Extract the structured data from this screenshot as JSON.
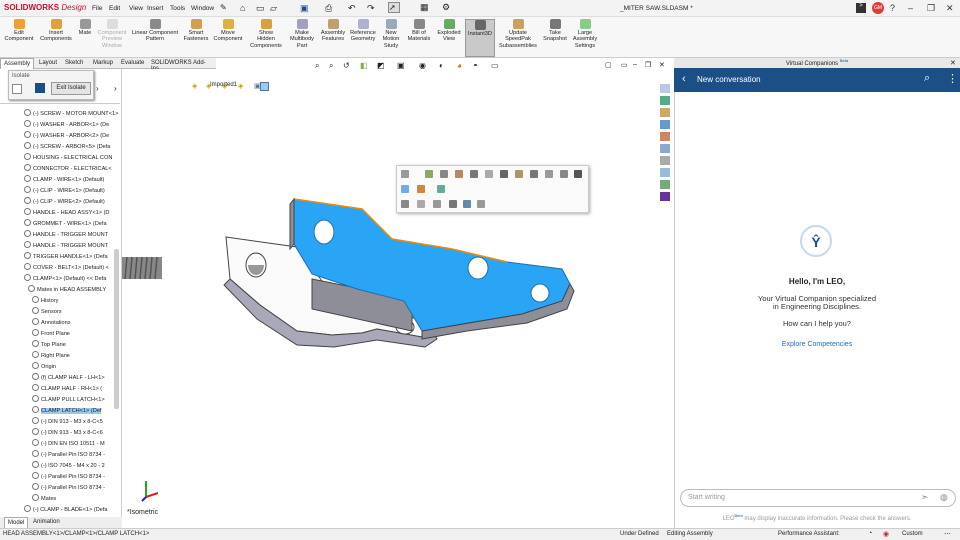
{
  "title_bar": {
    "logo_brand": "SOLIDWORKS",
    "logo_suffix": "Design",
    "menus": [
      "File",
      "Edit",
      "View",
      "Insert",
      "Tools",
      "Window"
    ],
    "filename": "_MITER SAW.SLDASM *",
    "user_initials": "GM"
  },
  "ribbon": {
    "buttons": [
      {
        "l1": "Edit",
        "l2": "Component",
        "l3": ""
      },
      {
        "l1": "Insert",
        "l2": "Components",
        "l3": ""
      },
      {
        "l1": "Mate",
        "l2": "",
        "l3": ""
      },
      {
        "l1": "Component",
        "l2": "Preview",
        "l3": "Window"
      },
      {
        "l1": "Linear Component",
        "l2": "Pattern",
        "l3": ""
      },
      {
        "l1": "Smart",
        "l2": "Fasteners",
        "l3": ""
      },
      {
        "l1": "Move",
        "l2": "Component",
        "l3": ""
      },
      {
        "l1": "Show",
        "l2": "Hidden",
        "l3": "Components"
      },
      {
        "l1": "Make",
        "l2": "Multibody",
        "l3": "Part"
      },
      {
        "l1": "Assembly",
        "l2": "Features",
        "l3": ""
      },
      {
        "l1": "Reference",
        "l2": "Geometry",
        "l3": ""
      },
      {
        "l1": "New",
        "l2": "Motion",
        "l3": "Study"
      },
      {
        "l1": "Bill of",
        "l2": "Materials",
        "l3": ""
      },
      {
        "l1": "Exploded",
        "l2": "View",
        "l3": ""
      },
      {
        "l1": "Instant3D",
        "l2": "",
        "l3": ""
      },
      {
        "l1": "Update",
        "l2": "SpeedPak",
        "l3": "Subassemblies"
      },
      {
        "l1": "Take",
        "l2": "Snapshot",
        "l3": ""
      },
      {
        "l1": "Large",
        "l2": "Assembly",
        "l3": "Settings"
      }
    ]
  },
  "cmd_tabs": [
    "Assembly",
    "Layout",
    "Sketch",
    "Markup",
    "Evaluate",
    "SOLIDWORKS Add-Ins"
  ],
  "isolate_popup": {
    "title": "Isolate",
    "exit_label": "Exit Isolate"
  },
  "breadcrumb_label": "Imported1",
  "tree": [
    "(-) SCREW - MOTOR MOUNT<1>",
    "(-) WASHER - ARBOR<1> (De",
    "(-) WASHER - ARBOR<2> (De",
    "(-) SCREW - ARBOR<5> (Defa",
    "HOUSING - ELECTRICAL CON",
    "CONNECTOR - ELECTRICAL<",
    "CLAMP - WIRE<1> (Default)",
    "(-) CLIP - WIRE<1> (Default)",
    "(-) CLIP - WIRE<2> (Default)",
    "HANDLE - HEAD ASSY<1> (D",
    "GROMMET - WIRE<1> (Defa",
    "HANDLE - TRIGGER MOUNT",
    "HANDLE - TRIGGER MOUNT",
    "TRIGGER HANDLE<1> (Defa",
    "COVER - BELT<1> (Default) <",
    "CLAMP<1> (Default) << Defa",
    "Mates in HEAD ASSEMBLY",
    "History",
    "Sensors",
    "Annotations",
    "Front Plane",
    "Top Plane",
    "Right Plane",
    "Origin",
    "(f) CLAMP HALF - LH<1>",
    "CLAMP HALF - RH<1> (",
    "CLAMP PULL LATCH<1>",
    "CLAMP LATCH<1> (Def",
    "(-) DIN 913 - M3 x 8-C<5",
    "(-) DIN 913 - M3 x 8-C<6",
    "(-) DIN EN ISO 10511 - M",
    "(-) Parallel Pin ISO 8734 -",
    "(-) ISO 7045 - M4 x 20 - 2",
    "(-) Parallel Pin ISO 8734 -",
    "(-) Parallel Pin ISO 8734 -",
    "Mates",
    "(-) CLAMP - BLADE<1> (Defa"
  ],
  "bottom_tabs": [
    "Model",
    "Animation"
  ],
  "view_label": "*Isometric",
  "companion": {
    "header": "Virtual Companions",
    "header_badge": "Beta",
    "conversation_title": "New conversation",
    "greeting": "Hello, I'm LEO,",
    "intro_l1": "Your Virtual Companion specialized",
    "intro_l2": "in Engineering Disciplines.",
    "question": "How can I help you?",
    "explore": "Explore Competencies",
    "input_placeholder": "Start writing",
    "disclaimer_name": "LEO",
    "disclaimer_badge": "Beta",
    "disclaimer_text": "may display inaccurate information. Please check the answers."
  },
  "status": {
    "path": "HEAD ASSEMBLY<1>/CLAMP<1>/CLAMP LATCH<1>",
    "under_defined": "Under Defined",
    "editing": "Editing Assembly",
    "perf": "Performance Assistant:",
    "units": "Custom"
  },
  "colors": {
    "accent": "#1d4f87",
    "selection": "#2aa4f4",
    "edge": "#f08a00"
  }
}
